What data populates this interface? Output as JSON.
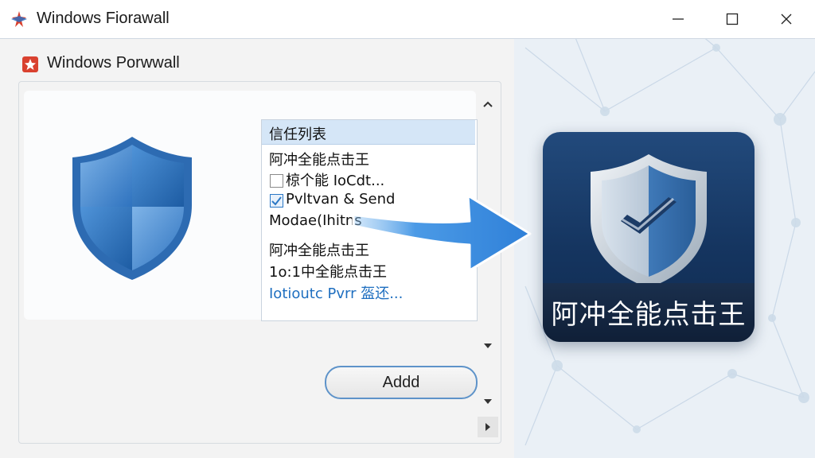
{
  "window": {
    "title": "Windows Fiorawall",
    "controls": [
      "minimize-icon",
      "maximize-icon",
      "close-icon"
    ]
  },
  "panel": {
    "subheader": "Windows Porwwall",
    "trust_list": {
      "header": "信任列表",
      "items": [
        {
          "text": "阿冲全能点击王",
          "checkbox": null
        },
        {
          "text": "椋个能 IoCdt...",
          "checkbox": "unchecked"
        },
        {
          "text": "Pvltvan & Send",
          "checkbox": "checked"
        },
        {
          "text": "Modae(Ihitns",
          "checkbox": null
        },
        {
          "text": "阿冲全能点击王",
          "checkbox": null
        },
        {
          "text": "1o:1中全能点击王",
          "checkbox": null
        },
        {
          "text": "Iotioutc Pvrr 盔还...",
          "checkbox": null,
          "style": "link"
        }
      ]
    },
    "add_button": "Addd"
  },
  "tile": {
    "label": "阿冲全能点击王"
  },
  "colors": {
    "accent": "#2b78c5",
    "tile_bg": "#153560",
    "arrow": "#3d8ee0"
  }
}
